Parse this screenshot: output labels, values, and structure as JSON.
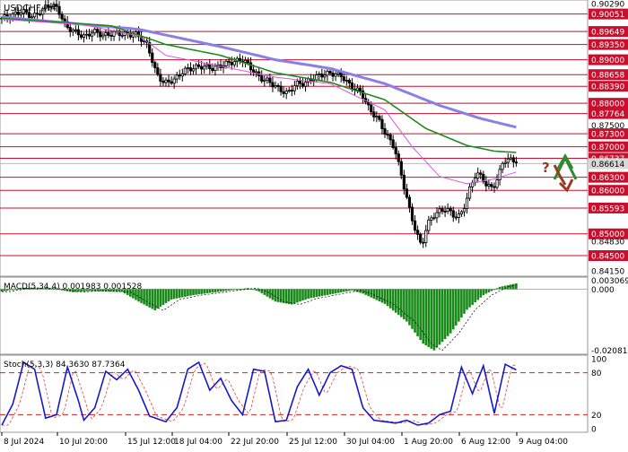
{
  "chart_data": [
    {
      "type": "candlestick",
      "title": "USDCHF,H4",
      "panel": "price",
      "y_ticks": [
        "0.90290",
        "0.90051",
        "0.89649",
        "0.89350",
        "0.89000",
        "0.88658",
        "0.88390",
        "0.88000",
        "0.87764",
        "0.87500",
        "0.87300",
        "0.87000",
        "0.86737",
        "0.86614",
        "0.86300",
        "0.86000",
        "0.85593",
        "0.85000",
        "0.84830",
        "0.84500",
        "0.84150"
      ],
      "levels": [
        0.90051,
        0.89649,
        0.8935,
        0.89,
        0.88658,
        0.8839,
        0.88,
        0.87764,
        0.873,
        0.87,
        0.86737,
        0.863,
        0.86,
        0.85593,
        0.85,
        0.845
      ],
      "last_price": 0.86614,
      "x_ticks": [
        "8 Jul 2024",
        "10 Jul 20:00",
        "15 Jul 12:00",
        "18 Jul 04:00",
        "22 Jul 20:00",
        "25 Jul 12:00",
        "30 Jul 04:00",
        "1 Aug 20:00",
        "6 Aug 12:00",
        "9 Aug 04:00"
      ],
      "price_anchors": [
        [
          0,
          0.8995
        ],
        [
          4,
          0.9
        ],
        [
          8,
          0.9012
        ],
        [
          12,
          0.8998
        ],
        [
          16,
          0.9017
        ],
        [
          18,
          0.9028
        ],
        [
          21,
          0.9018
        ],
        [
          24,
          0.8976
        ],
        [
          28,
          0.8962
        ],
        [
          31,
          0.8952
        ],
        [
          34,
          0.8966
        ],
        [
          38,
          0.8955
        ],
        [
          42,
          0.8962
        ],
        [
          46,
          0.8958
        ],
        [
          50,
          0.8958
        ],
        [
          54,
          0.8932
        ],
        [
          57,
          0.8868
        ],
        [
          60,
          0.8846
        ],
        [
          64,
          0.8855
        ],
        [
          67,
          0.8875
        ],
        [
          71,
          0.8882
        ],
        [
          74,
          0.8885
        ],
        [
          78,
          0.888
        ],
        [
          82,
          0.889
        ],
        [
          85,
          0.8895
        ],
        [
          89,
          0.89
        ],
        [
          92,
          0.8878
        ],
        [
          95,
          0.8858
        ],
        [
          98,
          0.8851
        ],
        [
          102,
          0.8832
        ],
        [
          105,
          0.8822
        ],
        [
          108,
          0.8845
        ],
        [
          111,
          0.8845
        ],
        [
          115,
          0.886
        ],
        [
          119,
          0.8868
        ],
        [
          122,
          0.8868
        ],
        [
          125,
          0.8862
        ],
        [
          128,
          0.8839
        ],
        [
          132,
          0.8825
        ],
        [
          135,
          0.8785
        ],
        [
          138,
          0.8765
        ],
        [
          141,
          0.8728
        ],
        [
          144,
          0.87
        ],
        [
          147,
          0.8625
        ],
        [
          150,
          0.8545
        ],
        [
          152,
          0.8505
        ],
        [
          154,
          0.847
        ],
        [
          156,
          0.852
        ],
        [
          158,
          0.854
        ],
        [
          160,
          0.855
        ],
        [
          163,
          0.8558
        ],
        [
          166,
          0.8541
        ],
        [
          168,
          0.854
        ],
        [
          170,
          0.857
        ],
        [
          172,
          0.861
        ],
        [
          174,
          0.864
        ],
        [
          176,
          0.863
        ],
        [
          178,
          0.861
        ],
        [
          180,
          0.8605
        ],
        [
          182,
          0.863
        ],
        [
          184,
          0.867
        ],
        [
          186,
          0.867
        ],
        [
          188,
          0.8668
        ]
      ],
      "ma_anchors": {
        "slow": [
          [
            0,
            0.8998
          ],
          [
            50,
            0.897
          ],
          [
            80,
            0.893
          ],
          [
            100,
            0.89
          ],
          [
            120,
            0.888
          ],
          [
            140,
            0.8845
          ],
          [
            160,
            0.8795
          ],
          [
            175,
            0.8765
          ],
          [
            188,
            0.8745
          ]
        ],
        "mid": [
          [
            0,
            0.8995
          ],
          [
            40,
            0.8978
          ],
          [
            60,
            0.8935
          ],
          [
            80,
            0.891
          ],
          [
            100,
            0.887
          ],
          [
            120,
            0.8848
          ],
          [
            140,
            0.8808
          ],
          [
            155,
            0.8742
          ],
          [
            170,
            0.8703
          ],
          [
            180,
            0.869
          ],
          [
            188,
            0.8687
          ]
        ],
        "fast": [
          [
            0,
            0.8993
          ],
          [
            30,
            0.898
          ],
          [
            50,
            0.8955
          ],
          [
            60,
            0.891
          ],
          [
            80,
            0.8885
          ],
          [
            100,
            0.886
          ],
          [
            120,
            0.8845
          ],
          [
            140,
            0.8785
          ],
          [
            150,
            0.87
          ],
          [
            160,
            0.8632
          ],
          [
            170,
            0.8615
          ],
          [
            180,
            0.8626
          ],
          [
            188,
            0.8642
          ]
        ]
      },
      "series": [
        {
          "name": "slow MA",
          "color": "#8a7fe8"
        },
        {
          "name": "mid MA",
          "color": "#1f8a1f"
        },
        {
          "name": "fast MA",
          "color": "#e055e0"
        }
      ],
      "annotations": {
        "up_arrow_color": "#2e8b2e",
        "down_arrow_color": "#9a3a1f",
        "question": "?"
      }
    },
    {
      "type": "histogram",
      "panel": "macd",
      "label": "MACD(5,34,4) 0.001983 0.001528",
      "y_ticks": [
        "0.003069",
        "0.000",
        "-0.020811"
      ],
      "ylim": [
        -0.0215,
        0.0035
      ],
      "hist_anchors": [
        [
          0,
          -0.0008
        ],
        [
          8,
          0.0005
        ],
        [
          18,
          0.0002
        ],
        [
          26,
          -0.001
        ],
        [
          32,
          -0.0006
        ],
        [
          44,
          -0.0009
        ],
        [
          50,
          -0.0042
        ],
        [
          56,
          -0.0072
        ],
        [
          62,
          -0.0035
        ],
        [
          70,
          -0.002
        ],
        [
          80,
          -0.0008
        ],
        [
          90,
          0.0004
        ],
        [
          94,
          -0.0008
        ],
        [
          100,
          -0.0042
        ],
        [
          106,
          -0.0052
        ],
        [
          112,
          -0.0032
        ],
        [
          120,
          -0.0018
        ],
        [
          128,
          -0.0004
        ],
        [
          132,
          -0.0015
        ],
        [
          140,
          -0.005
        ],
        [
          148,
          -0.011
        ],
        [
          154,
          -0.0185
        ],
        [
          158,
          -0.0208
        ],
        [
          164,
          -0.015
        ],
        [
          170,
          -0.007
        ],
        [
          176,
          -0.002
        ],
        [
          182,
          0.0008
        ],
        [
          188,
          0.00198
        ]
      ],
      "color": "#188a18"
    },
    {
      "type": "line",
      "panel": "stochastic",
      "label": "Stoch(5,3,3) 84.3630 87.7364",
      "y_ticks": [
        "100",
        "80",
        "20",
        "0"
      ],
      "ylim": [
        0,
        100
      ],
      "overbought": 80,
      "oversold": 20,
      "k_anchors": [
        [
          0,
          5
        ],
        [
          4,
          35
        ],
        [
          8,
          95
        ],
        [
          12,
          85
        ],
        [
          16,
          15
        ],
        [
          20,
          20
        ],
        [
          24,
          88
        ],
        [
          28,
          40
        ],
        [
          30,
          12
        ],
        [
          34,
          30
        ],
        [
          38,
          82
        ],
        [
          42,
          70
        ],
        [
          46,
          85
        ],
        [
          50,
          55
        ],
        [
          54,
          18
        ],
        [
          60,
          10
        ],
        [
          64,
          30
        ],
        [
          68,
          85
        ],
        [
          72,
          95
        ],
        [
          76,
          55
        ],
        [
          80,
          72
        ],
        [
          84,
          40
        ],
        [
          88,
          20
        ],
        [
          92,
          85
        ],
        [
          96,
          82
        ],
        [
          100,
          10
        ],
        [
          104,
          12
        ],
        [
          108,
          60
        ],
        [
          112,
          85
        ],
        [
          116,
          48
        ],
        [
          120,
          80
        ],
        [
          124,
          90
        ],
        [
          128,
          85
        ],
        [
          132,
          30
        ],
        [
          136,
          12
        ],
        [
          140,
          10
        ],
        [
          144,
          8
        ],
        [
          148,
          12
        ],
        [
          152,
          5
        ],
        [
          156,
          8
        ],
        [
          160,
          20
        ],
        [
          164,
          25
        ],
        [
          168,
          88
        ],
        [
          172,
          50
        ],
        [
          176,
          90
        ],
        [
          180,
          22
        ],
        [
          184,
          92
        ],
        [
          188,
          84
        ]
      ],
      "colors": {
        "k": "#1818c8",
        "d": "#e04040",
        "line": "#cc2222"
      }
    }
  ]
}
